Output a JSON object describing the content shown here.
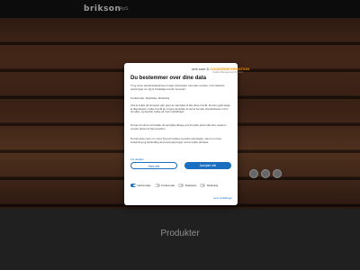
{
  "header": {
    "logo": "brikson",
    "tagline": "ApS"
  },
  "bottom": {
    "heading": "Produkter"
  },
  "cookie_dialog": {
    "brand_prefix": "one.com",
    "brand_ampersand": "&",
    "brand_name": "COOKIEINFORMATION",
    "brand_sub": "Cookie Management Platform",
    "title": "Du bestemmer over dine data",
    "paragraph1": "Vi og vores samarbejdspartnere bruger teknologier, herunder cookies, til at indsamle oplysninger om dig til forskellige formål, herunder:",
    "paragraph2": "Funktionelle, Statistiske, Marketing",
    "paragraph3": "Ved at trykke på 'Accepter alle' giver du samtykke til alle disse formål. Du kan også vælge at tilkendegive, hvilke formål du vil give samtykke til ved at benytte checkboksene ud for formålet, og derefter trykke på 'Gem indstillinger'.",
    "paragraph4": "Du kan til enhver tid trække dit samtykke tilbage ved at trykke på det lille ikon nederst i venstre hjørne af hjemmesiden.",
    "paragraph5": "Du kan læse mere om vores brug af cookies og andre teknologier, samt om vores indsamling og behandling af personoplysninger ved at trykke på linket.",
    "link": "Vis detaljer",
    "deny_label": "Afvis alle",
    "accept_label": "Accepter alle",
    "toggles": [
      {
        "label": "Nødvendige",
        "on": true
      },
      {
        "label": "Funktionelle",
        "on": false
      },
      {
        "label": "Statistiske",
        "on": false
      },
      {
        "label": "Marketing",
        "on": false
      }
    ],
    "save_label": "Gem indstillinger"
  }
}
